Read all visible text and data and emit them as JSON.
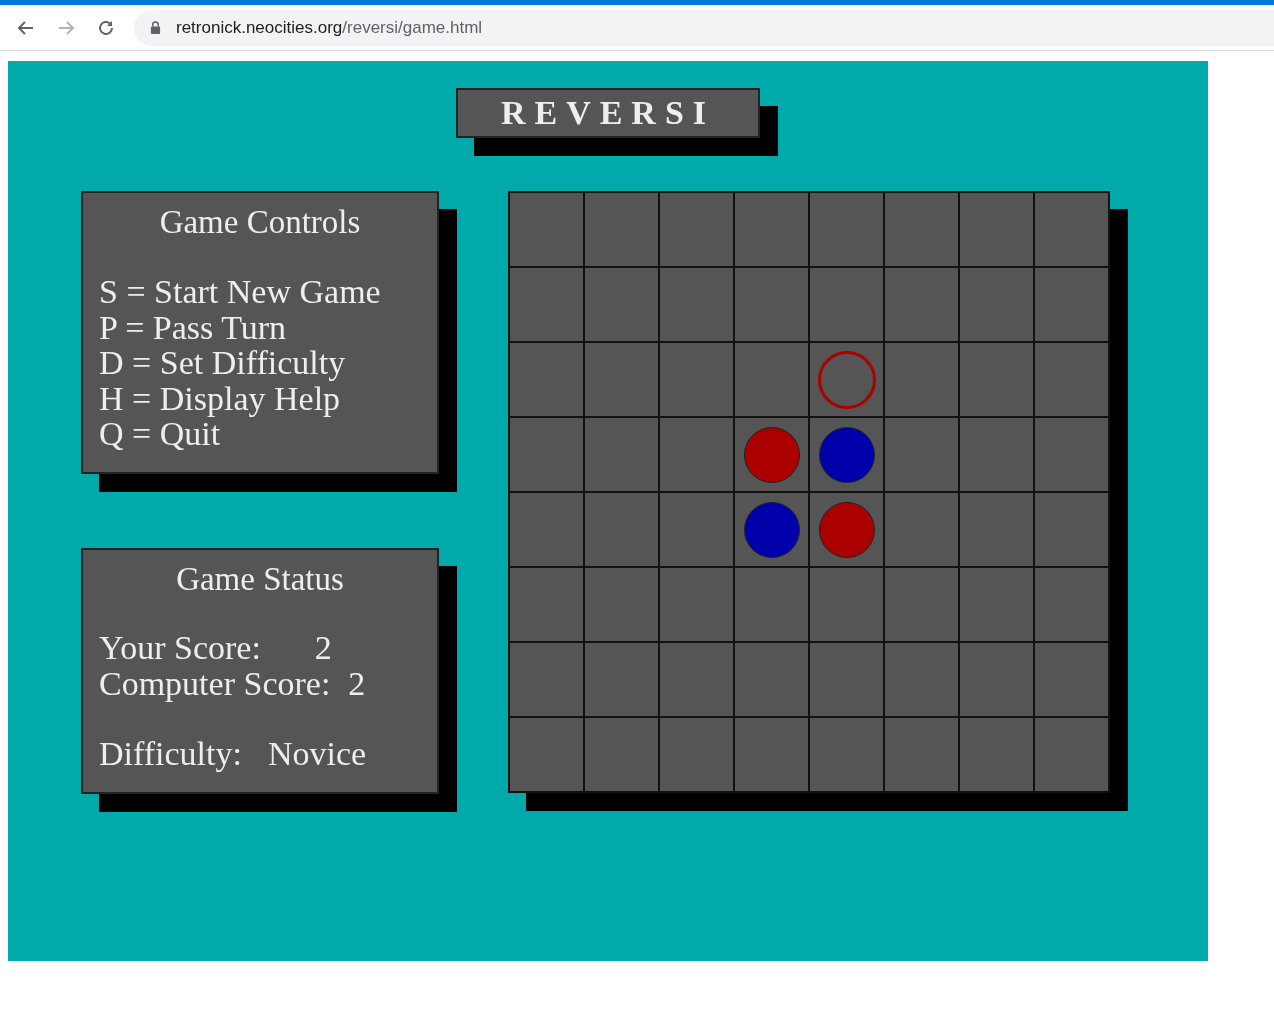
{
  "browser": {
    "url_host": "retronick.neocities.org",
    "url_path": "/reversi/game.html"
  },
  "title": "REVERSI",
  "controls": {
    "heading": "Game Controls",
    "lines": [
      "S = Start New Game",
      "P = Pass Turn",
      "D = Set Difficulty",
      "H = Display Help",
      "Q = Quit"
    ]
  },
  "status": {
    "heading": "Game Status",
    "sections": [
      {
        "rows": [
          {
            "label": "Your Score:",
            "value": "2"
          },
          {
            "label": "Computer Score:",
            "value": "2"
          }
        ]
      },
      {
        "rows": [
          {
            "label": "Difficulty:",
            "value": "Novice"
          }
        ]
      }
    ]
  },
  "board": {
    "rows": [
      [
        {
          "kind": "empty"
        },
        {
          "kind": "empty"
        },
        {
          "kind": "empty"
        },
        {
          "kind": "empty"
        },
        {
          "kind": "empty"
        },
        {
          "kind": "empty"
        },
        {
          "kind": "empty"
        },
        {
          "kind": "empty"
        }
      ],
      [
        {
          "kind": "empty"
        },
        {
          "kind": "empty"
        },
        {
          "kind": "empty"
        },
        {
          "kind": "empty"
        },
        {
          "kind": "empty"
        },
        {
          "kind": "empty"
        },
        {
          "kind": "empty"
        },
        {
          "kind": "empty"
        }
      ],
      [
        {
          "kind": "empty"
        },
        {
          "kind": "empty"
        },
        {
          "kind": "empty"
        },
        {
          "kind": "empty"
        },
        {
          "kind": "hint",
          "color": "#aa0000"
        },
        {
          "kind": "empty"
        },
        {
          "kind": "empty"
        },
        {
          "kind": "empty"
        }
      ],
      [
        {
          "kind": "empty"
        },
        {
          "kind": "empty"
        },
        {
          "kind": "empty"
        },
        {
          "kind": "piece",
          "color": "#aa0000"
        },
        {
          "kind": "piece",
          "color": "#0000aa"
        },
        {
          "kind": "empty"
        },
        {
          "kind": "empty"
        },
        {
          "kind": "empty"
        }
      ],
      [
        {
          "kind": "empty"
        },
        {
          "kind": "empty"
        },
        {
          "kind": "empty"
        },
        {
          "kind": "piece",
          "color": "#0000aa"
        },
        {
          "kind": "piece",
          "color": "#aa0000"
        },
        {
          "kind": "empty"
        },
        {
          "kind": "empty"
        },
        {
          "kind": "empty"
        }
      ],
      [
        {
          "kind": "empty"
        },
        {
          "kind": "empty"
        },
        {
          "kind": "empty"
        },
        {
          "kind": "empty"
        },
        {
          "kind": "empty"
        },
        {
          "kind": "empty"
        },
        {
          "kind": "empty"
        },
        {
          "kind": "empty"
        }
      ],
      [
        {
          "kind": "empty"
        },
        {
          "kind": "empty"
        },
        {
          "kind": "empty"
        },
        {
          "kind": "empty"
        },
        {
          "kind": "empty"
        },
        {
          "kind": "empty"
        },
        {
          "kind": "empty"
        },
        {
          "kind": "empty"
        }
      ],
      [
        {
          "kind": "empty"
        },
        {
          "kind": "empty"
        },
        {
          "kind": "empty"
        },
        {
          "kind": "empty"
        },
        {
          "kind": "empty"
        },
        {
          "kind": "empty"
        },
        {
          "kind": "empty"
        },
        {
          "kind": "empty"
        }
      ]
    ]
  }
}
